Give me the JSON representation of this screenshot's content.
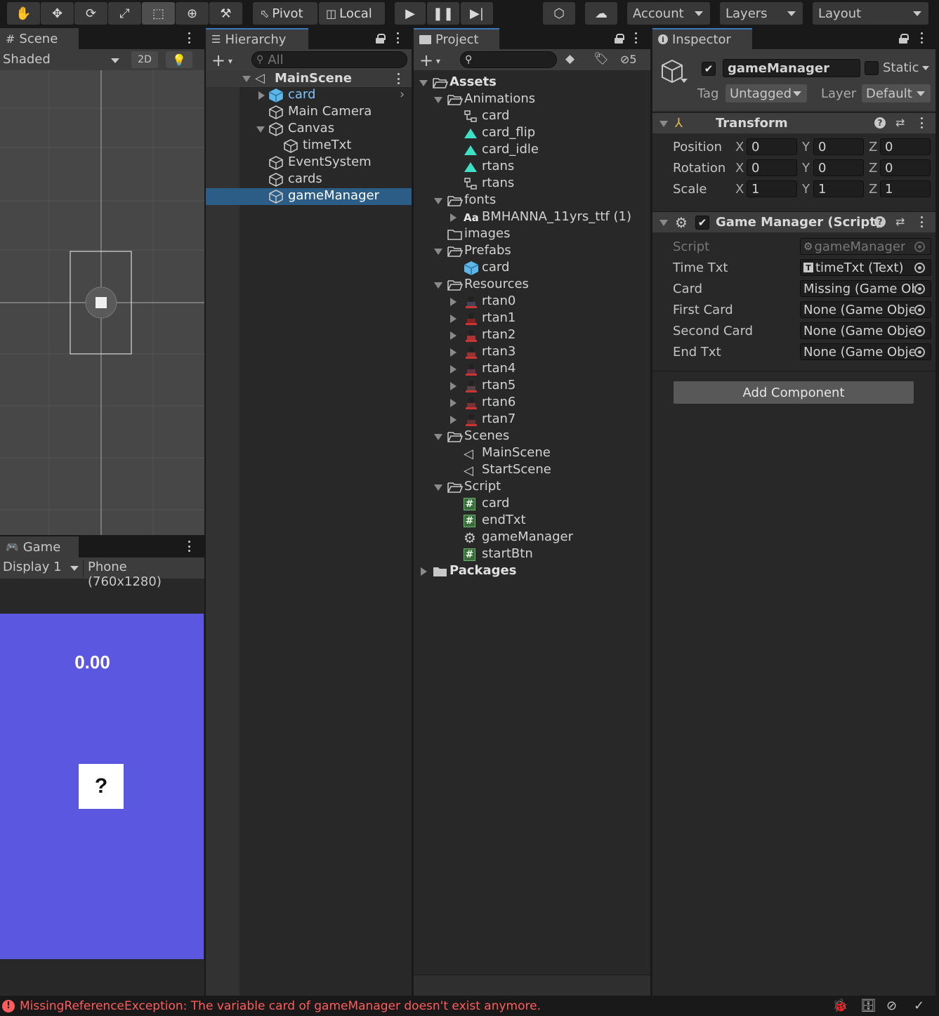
{
  "toolbar": {
    "pivot_label": "Pivot",
    "local_label": "Local",
    "account_label": "Account",
    "layers_label": "Layers",
    "layout_label": "Layout"
  },
  "scene": {
    "tab_label": "Scene",
    "shading_mode": "Shaded",
    "mode_2d": "2D",
    "bg_color": "#474747"
  },
  "game": {
    "tab_label": "Game",
    "display": "Display 1",
    "resolution": "Phone (760x1280)",
    "timer_text": "0.00",
    "card_text": "?",
    "bg_color": "#5b57e1"
  },
  "hierarchy": {
    "tab_label": "Hierarchy",
    "search_placeholder": "All",
    "scene_name": "MainScene",
    "items": [
      {
        "label": "card",
        "type": "prefab"
      },
      {
        "label": "Main Camera",
        "type": "object"
      },
      {
        "label": "Canvas",
        "type": "object"
      },
      {
        "label": "timeTxt",
        "type": "object"
      },
      {
        "label": "EventSystem",
        "type": "object"
      },
      {
        "label": "cards",
        "type": "object"
      },
      {
        "label": "gameManager",
        "type": "object",
        "selected": true
      }
    ]
  },
  "project": {
    "tab_label": "Project",
    "hidden_count": "5",
    "tree": [
      {
        "label": "Assets",
        "type": "folder-open",
        "bold": true
      },
      {
        "label": "Animations",
        "type": "folder-open"
      },
      {
        "label": "card",
        "type": "anim-controller"
      },
      {
        "label": "card_flip",
        "type": "anim"
      },
      {
        "label": "card_idle",
        "type": "anim"
      },
      {
        "label": "rtans",
        "type": "anim"
      },
      {
        "label": "rtans",
        "type": "anim-controller"
      },
      {
        "label": "fonts",
        "type": "folder-open"
      },
      {
        "label": "BMHANNA_11yrs_ttf (1)",
        "type": "font"
      },
      {
        "label": "images",
        "type": "folder"
      },
      {
        "label": "Prefabs",
        "type": "folder-open"
      },
      {
        "label": "card",
        "type": "prefab"
      },
      {
        "label": "Resources",
        "type": "folder-open"
      },
      {
        "label": "rtan0",
        "type": "sprite"
      },
      {
        "label": "rtan1",
        "type": "sprite"
      },
      {
        "label": "rtan2",
        "type": "sprite"
      },
      {
        "label": "rtan3",
        "type": "sprite"
      },
      {
        "label": "rtan4",
        "type": "sprite"
      },
      {
        "label": "rtan5",
        "type": "sprite"
      },
      {
        "label": "rtan6",
        "type": "sprite"
      },
      {
        "label": "rtan7",
        "type": "sprite"
      },
      {
        "label": "Scenes",
        "type": "folder-open"
      },
      {
        "label": "MainScene",
        "type": "scene"
      },
      {
        "label": "StartScene",
        "type": "scene"
      },
      {
        "label": "Script",
        "type": "folder-open"
      },
      {
        "label": "card",
        "type": "script"
      },
      {
        "label": "endTxt",
        "type": "script"
      },
      {
        "label": "gameManager",
        "type": "gear"
      },
      {
        "label": "startBtn",
        "type": "script"
      },
      {
        "label": "Packages",
        "type": "folder-filled",
        "bold": true
      }
    ]
  },
  "inspector": {
    "tab_label": "Inspector",
    "object_name": "gameManager",
    "static_label": "Static",
    "tag_label": "Tag",
    "tag_value": "Untagged",
    "layer_label": "Layer",
    "layer_value": "Default",
    "transform": {
      "title": "Transform",
      "rows": [
        {
          "label": "Position",
          "x": "0",
          "y": "0",
          "z": "0"
        },
        {
          "label": "Rotation",
          "x": "0",
          "y": "0",
          "z": "0"
        },
        {
          "label": "Scale",
          "x": "1",
          "y": "1",
          "z": "1"
        }
      ],
      "axis_x": "X",
      "axis_y": "Y",
      "axis_z": "Z"
    },
    "script_component": {
      "title": "Game Manager (Script)",
      "fields": [
        {
          "label": "Script",
          "value": "gameManager",
          "disabled": true
        },
        {
          "label": "Time Txt",
          "value": "timeTxt (Text)"
        },
        {
          "label": "Card",
          "value": "Missing (Game Ob"
        },
        {
          "label": "First Card",
          "value": "None (Game Obje"
        },
        {
          "label": "Second Card",
          "value": "None (Game Obje"
        },
        {
          "label": "End Txt",
          "value": "None (Game Obje"
        }
      ]
    },
    "add_component_label": "Add Component"
  },
  "status": {
    "error_text": "MissingReferenceException: The variable card of gameManager doesn't exist anymore.",
    "error_color": "#ff5c5c"
  }
}
